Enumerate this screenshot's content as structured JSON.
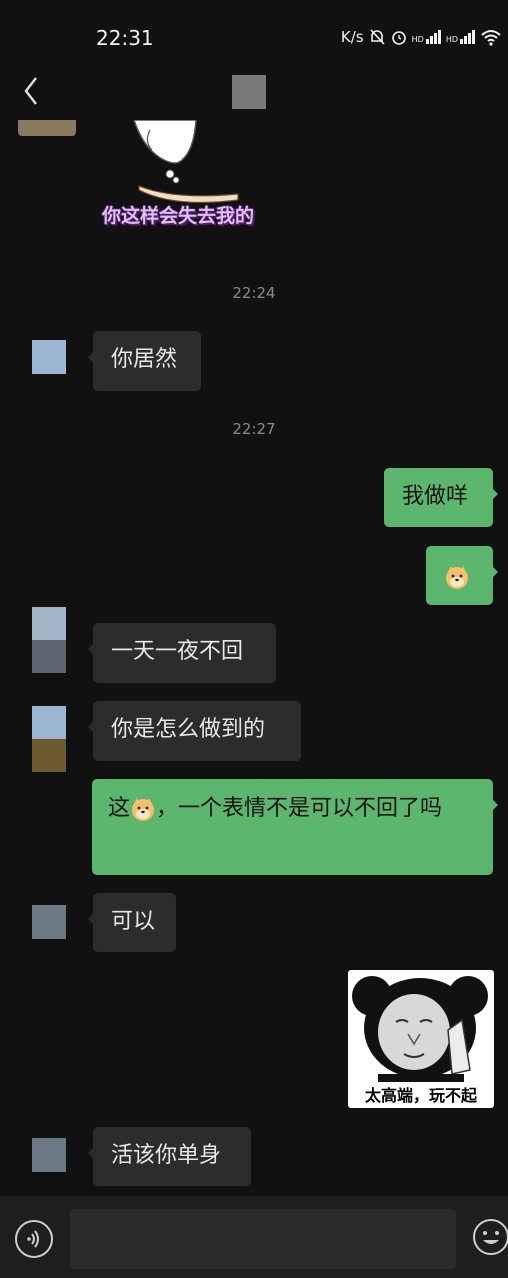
{
  "status_bar": {
    "time": "22:31",
    "speed_unit": "K/s",
    "network_1": "HD",
    "network_2": "HD"
  },
  "header": {
    "back_icon": "chevron-left-icon"
  },
  "messages": {
    "sticker_top_caption": "你这样会失去我的",
    "timestamp_1": "22:24",
    "msg_1": "你居然",
    "timestamp_2": "22:27",
    "msg_2": "我做咩",
    "msg_4": "一天一夜不回",
    "msg_5": "你是怎么做到的",
    "msg_6_prefix": "这",
    "msg_6_suffix": "，一个表情不是可以不回了吗",
    "msg_7": "可以",
    "panda_caption": "太高端，玩不起",
    "msg_9": "活该你单身"
  },
  "input": {
    "placeholder": ""
  },
  "colors": {
    "background": "#111111",
    "incoming": "#2c2c2c",
    "outgoing": "#5db66e",
    "timestamp": "#8a8a8a"
  }
}
